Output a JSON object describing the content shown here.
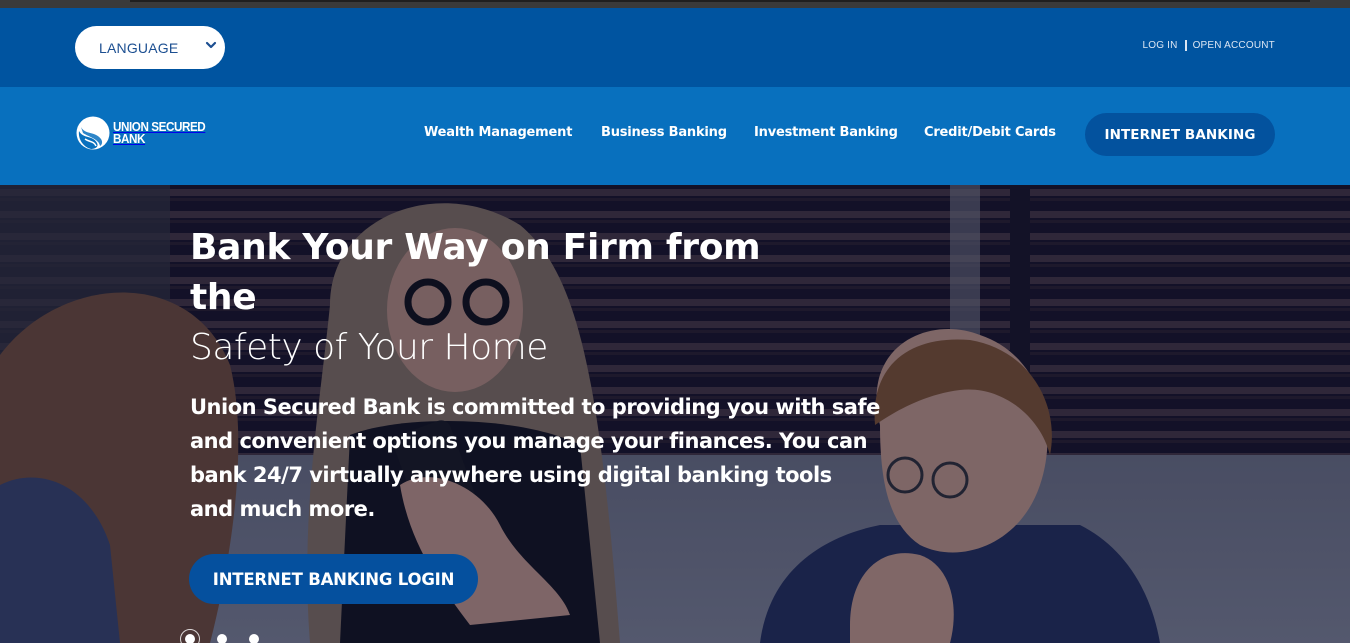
{
  "topbar": {
    "language_select": {
      "selected": "LANGUAGE",
      "icon": "chevron-down-icon"
    },
    "links": [
      {
        "label": "LOG IN"
      },
      {
        "label": "OPEN ACCOUNT"
      }
    ]
  },
  "navbar": {
    "logo": {
      "line1": "UNION SECURED",
      "line2": "BANK",
      "icon": "globe-wave-icon"
    },
    "links": [
      {
        "label": "Wealth Management"
      },
      {
        "label": "Business Banking"
      },
      {
        "label": "Investment Banking"
      },
      {
        "label": "Credit/Debit Cards"
      }
    ],
    "cta_label": "INTERNET BANKING"
  },
  "hero": {
    "title": "Bank Your Way on Firm from the",
    "subtitle": "Safety of Your Home",
    "text": "Union Secured Bank is committed to providing you with safe and convenient options you manage your finances. You can bank 24/7 virtually anywhere using digital banking tools and much more.",
    "button_label": "INTERNET BANKING LOGIN",
    "carousel": {
      "slide_count": 3,
      "active_slide": 1
    }
  },
  "colors": {
    "topbar_bg": "#0054a0",
    "navbar_bg": "#0870be",
    "button_bg": "#03529e"
  }
}
